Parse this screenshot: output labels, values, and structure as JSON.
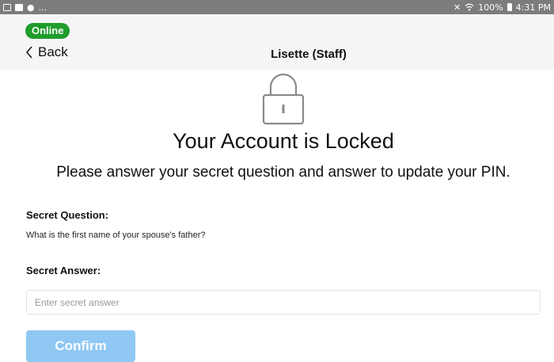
{
  "status_bar": {
    "left_icons": [
      "image-icon",
      "picture-icon",
      "apple-icon"
    ],
    "left_more": "...",
    "right_icons": [
      "mute-icon",
      "wifi-icon",
      "battery-icon"
    ],
    "battery": "100%",
    "time": "4:31 PM"
  },
  "header": {
    "status_badge": "Online",
    "back_label": "Back",
    "title": "Lisette (Staff)"
  },
  "lock": {
    "icon": "lock-icon"
  },
  "main": {
    "title": "Your Account is Locked",
    "subtitle": "Please answer your secret question and answer to update your PIN."
  },
  "form": {
    "question_label": "Secret Question:",
    "question_text": "What is the first name of your spouse's father?",
    "answer_label": "Secret Answer:",
    "answer_value": "",
    "answer_placeholder": "Enter secret answer",
    "confirm_label": "Confirm"
  },
  "colors": {
    "status_bar": "#7c7c7c",
    "online": "#1f9d2b",
    "confirm_button": "#8ec8f3",
    "header_bg": "#f5f5f5"
  }
}
